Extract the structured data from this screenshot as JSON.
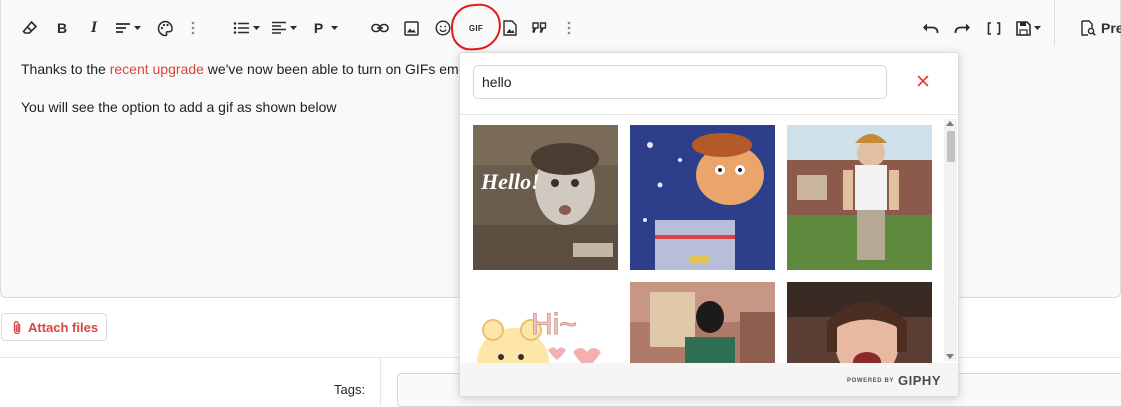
{
  "toolbar": {
    "gif_label": "GIF",
    "paragraph_label": "P",
    "preview_label": "Pre",
    "accent_color": "#e31b1b"
  },
  "content": {
    "line1_before": "Thanks to the ",
    "line1_link": "recent upgrade",
    "line1_after": " we've now been able to turn on GIFs emb",
    "line2": "You will see the option to add a gif as shown below",
    "link_color": "#d9463e"
  },
  "attach": {
    "label": "Attach files"
  },
  "tags": {
    "label": "Tags:"
  },
  "gif_picker": {
    "search_value": "hello",
    "tiles": [
      {
        "caption": "Hello!"
      },
      {
        "caption": ""
      },
      {
        "caption": ""
      },
      {
        "caption": "Hi~"
      },
      {
        "caption": ""
      },
      {
        "caption": ""
      }
    ],
    "footer_small": "POWERED BY",
    "footer_brand": "GIPHY"
  }
}
